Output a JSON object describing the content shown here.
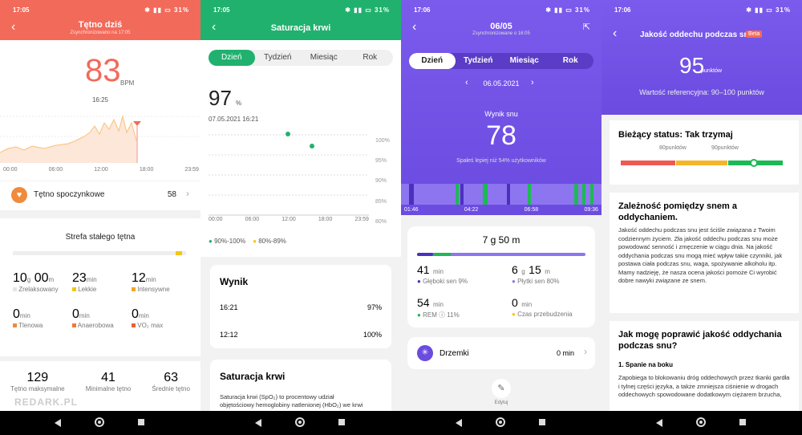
{
  "p1": {
    "time": "17:05",
    "battery": "31",
    "title": "Tętno dziś",
    "subtitle": "Zsynchronizowano na 17:05",
    "bpm": "83",
    "unit": "BPM",
    "bpm_time": "16:25",
    "axis": [
      "00:00",
      "06:00",
      "12:00",
      "18:00",
      "23:59"
    ],
    "resting_label": "Tętno spoczynkowe",
    "resting_value": "58",
    "zone_title": "Strefa stałego tętna",
    "zones": [
      {
        "v": "10",
        "u1": "g",
        "v2": "00",
        "u2": "m",
        "label": "Zrelaksowany",
        "color": "#e5e5e5"
      },
      {
        "v": "23",
        "u1": "min",
        "label": "Lekkie",
        "color": "#f5c518"
      },
      {
        "v": "12",
        "u1": "min",
        "label": "Intensywne",
        "color": "#f5a623"
      },
      {
        "v": "0",
        "u1": "min",
        "label": "Tlenowa",
        "color": "#f08a3c"
      },
      {
        "v": "0",
        "u1": "min",
        "label": "Anaerobowa",
        "color": "#ee7a3a"
      },
      {
        "v": "0",
        "u1": "min",
        "label": "VO₂ max",
        "color": "#e8603c"
      }
    ],
    "stats": [
      {
        "v": "129",
        "label": "Tętno maksymalne"
      },
      {
        "v": "41",
        "label": "Minimalne tętno"
      },
      {
        "v": "63",
        "label": "Średnie tętno"
      }
    ],
    "watermark": "REDARK.PL"
  },
  "p2": {
    "time": "17:05",
    "battery": "31",
    "title": "Saturacja krwi",
    "tabs": [
      "Dzień",
      "Tydzień",
      "Miesiąc",
      "Rok"
    ],
    "value": "97",
    "unit": "%",
    "date": "07.05.2021 16:21",
    "yaxis": [
      "100%",
      "95%",
      "90%",
      "85%",
      "80%"
    ],
    "xaxis": [
      "00:00",
      "06:00",
      "12:00",
      "18:00",
      "23:59"
    ],
    "legend": [
      "90%-100%",
      "80%-89%"
    ],
    "result_title": "Wynik",
    "rows": [
      {
        "t": "16:21",
        "v": "97%"
      },
      {
        "t": "12:12",
        "v": "100%"
      }
    ],
    "sat_title": "Saturacja krwi",
    "sat_text_1": "Saturacja krwi (SpO₂) to procentowy udział",
    "sat_text_2": "objętościowy hemoglobiny natlenionej (HbO₂) we krwi"
  },
  "p3": {
    "time": "17:06",
    "battery": "31",
    "title": "06/05",
    "subtitle": "Zsynchronizowane o 16:05",
    "tabs": [
      "Dzień",
      "Tydzień",
      "Miesiąc",
      "Rok"
    ],
    "date": "06.05.2021",
    "score_label": "Wynik snu",
    "score": "78",
    "score_text": "Spałeś lepiej niż 54% użytkowników",
    "times": [
      "01:46",
      "04:22",
      "06:58",
      "09:36"
    ],
    "total": "7 g 50 m",
    "deep": {
      "v": "41",
      "u": "min",
      "label": "Głęboki sen 9%"
    },
    "light": {
      "v": "6",
      "u1": "g",
      "v2": "15",
      "u2": "m",
      "label": "Płytki sen 80%"
    },
    "rem": {
      "v": "54",
      "u": "min",
      "label": "REM ⓘ 11%"
    },
    "awake": {
      "v": "0",
      "u": "min",
      "label": "Czas przebudzenia"
    },
    "nap_label": "Drzemki",
    "nap_value": "0 min",
    "edit_label": "Edytuj"
  },
  "p4": {
    "time": "17:06",
    "battery": "31",
    "title": "Jakość oddechu podczas snu",
    "beta": "Beta",
    "score": "95",
    "score_unit": "punktów",
    "reference": "Wartość referencyjna: 90–100 punktów",
    "status_title": "Bieżący status: Tak trzymaj",
    "ticks": [
      "80punktów",
      "90punktów"
    ],
    "sec1_title": "Zależność pomiędzy snem a oddychaniem.",
    "sec1_text": "Jakość oddechu podczas snu jest ściśle związana z Twoim codziennym życiem. Zła jakość oddechu podczas snu może powodować senność i zmęczenie w ciągu dnia. Na jakość oddychania podczas snu mogą mieć wpływ takie czynniki, jak postawa ciała podczas snu, waga, spożywanie alkoholu itp. Mamy nadzieję, że nasza ocena jakości pomoże Ci wyrobić dobre nawyki związane ze snem.",
    "sec2_title": "Jak mogę poprawić jakość oddychania podczas snu?",
    "sec2_sub": "1. Spanie na boku",
    "sec2_text": "Zapobiega to blokowaniu dróg oddechowych przez tkanki gardła i tylnej części języka, a także zmniejsza ciśnienie w drogach oddechowych spowodowane dodatkowym ciężarem brzucha,"
  }
}
